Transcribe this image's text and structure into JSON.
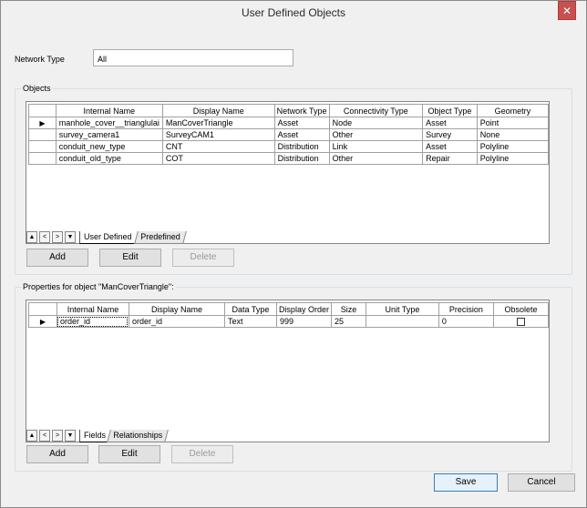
{
  "window": {
    "title": "User Defined Objects",
    "close_glyph": "✕"
  },
  "network_type": {
    "label": "Network Type",
    "value": "All"
  },
  "objects": {
    "group_title": "Objects",
    "columns": [
      "Internal Name",
      "Display Name",
      "Network Type",
      "Connectivity Type",
      "Object Type",
      "Geometry"
    ],
    "rows": [
      [
        "manhole_cover__trianglulai",
        "ManCoverTriangle",
        "Asset",
        "Node",
        "Asset",
        "Point"
      ],
      [
        "survey_camera1",
        "SurveyCAM1",
        "Asset",
        "Other",
        "Survey",
        "None"
      ],
      [
        "conduit_new_type",
        "CNT",
        "Distribution",
        "Link",
        "Asset",
        "Polyline"
      ],
      [
        "conduit_old_type",
        "COT",
        "Distribution",
        "Other",
        "Repair",
        "Polyline"
      ]
    ],
    "current_row_glyph": "▶",
    "tabs": [
      "User Defined",
      "Predefined"
    ],
    "buttons": {
      "add": "Add",
      "edit": "Edit",
      "delete": "Delete"
    }
  },
  "properties": {
    "group_title": "Properties for object \"ManCoverTriangle\":",
    "columns": [
      "Internal Name",
      "Display Name",
      "Data Type",
      "Display Order",
      "Size",
      "Unit Type",
      "Precision",
      "Obsolete"
    ],
    "rows": [
      [
        "order_id",
        "order_id",
        "Text",
        "999",
        "25",
        "",
        "0",
        ""
      ]
    ],
    "tabs": [
      "Fields",
      "Relationships"
    ],
    "buttons": {
      "add": "Add",
      "edit": "Edit",
      "delete": "Delete"
    }
  },
  "nav_glyphs": [
    "▲",
    "<",
    ">",
    "▼"
  ],
  "footer": {
    "save": "Save",
    "cancel": "Cancel"
  }
}
